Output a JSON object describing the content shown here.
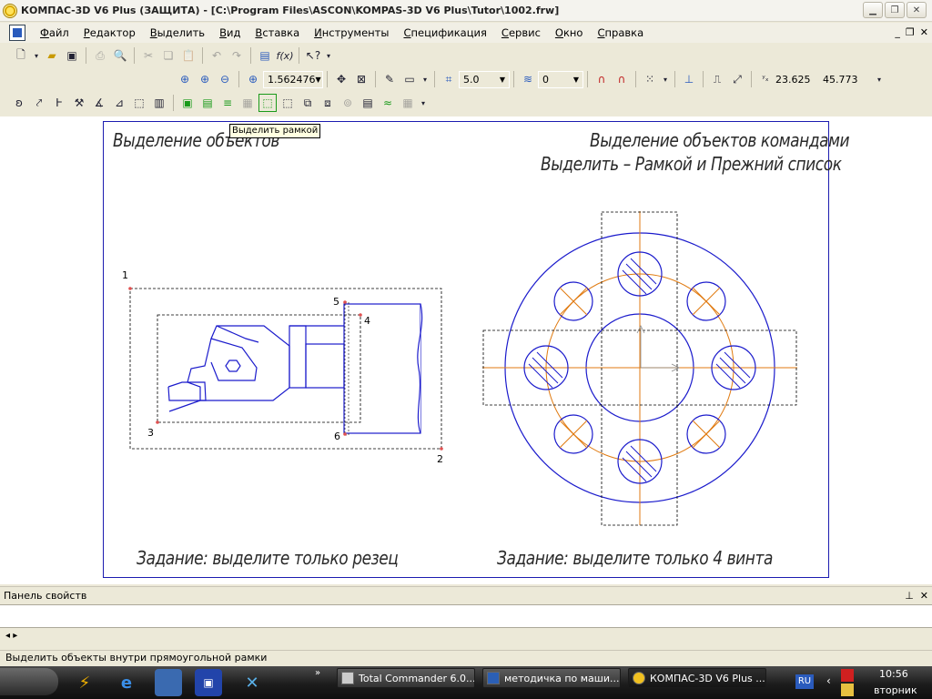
{
  "window": {
    "title": "КОМПАС-3D V6 Plus (ЗАЩИТА) - [C:\\Program Files\\ASCON\\KOMPAS-3D V6 Plus\\Tutor\\1002.frw]"
  },
  "menu": [
    "Файл",
    "Редактор",
    "Выделить",
    "Вид",
    "Вставка",
    "Инструменты",
    "Спецификация",
    "Сервис",
    "Окно",
    "Справка"
  ],
  "toolbar": {
    "zoom_value": "1.562476",
    "step_value": "5.0",
    "layer_value": "0",
    "coord_x": "23.625",
    "coord_y": "45.773"
  },
  "tooltip": "Выделить рамкой",
  "drawing": {
    "left_title": "Выделение объектов",
    "right_title_line1": "Выделение объектов командами",
    "right_title_line2": "Выделить – Рамкой и Прежний список",
    "left_task": "Задание: выделите только резец",
    "right_task": "Задание: выделите только 4 винта",
    "point_labels": [
      "1",
      "2",
      "3",
      "4",
      "5",
      "6"
    ]
  },
  "panel": {
    "title": "Панель свойств",
    "arrows": "◂ ▸"
  },
  "status": "Выделить объекты внутри прямоугольной рамки",
  "taskbar": {
    "tasks": [
      "Total Commander 6.0...",
      "методичка по маши...",
      "КОМПАС-3D V6 Plus ..."
    ],
    "lang": "RU",
    "time": "10:56",
    "day": "вторник"
  },
  "colors": {
    "contour": "#1b1bcc",
    "axis": "#e07a10",
    "marker": "#e05050"
  }
}
